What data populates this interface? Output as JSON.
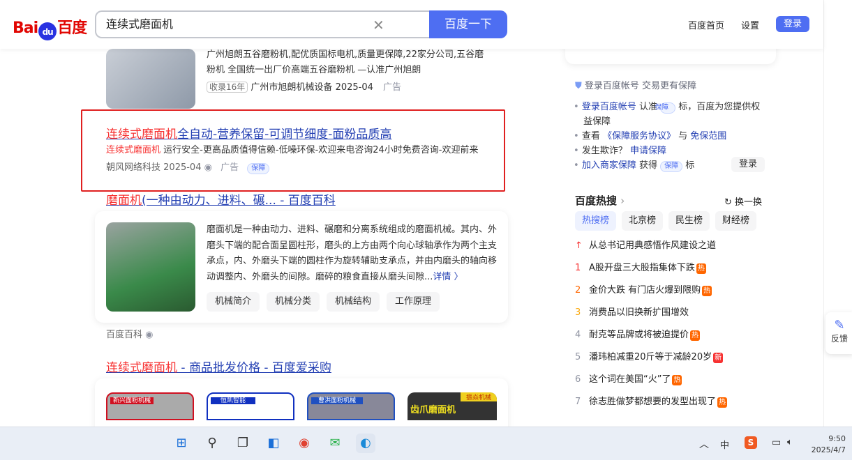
{
  "header": {
    "logo": "Bai度百度",
    "query": "连续式磨面机",
    "search_button": "百度一下",
    "home": "百度首页",
    "settings": "设置",
    "login": "登录"
  },
  "results": [
    {
      "desc": "广州旭朗五谷磨粉机,配优质国标电机,质量更保障,22家分公司,五谷磨粉机 全国统一出厂价高端五谷磨粉机 —认准广州旭朗",
      "badge": "收录16年",
      "source": "广州市旭朗机械设备",
      "date": "2025-04",
      "ad": "广告"
    },
    {
      "title_red": "连续式磨面机",
      "title_rest": "全自动-营养保留-可调节细度-面粉品质高",
      "desc_red": "连续式磨面机",
      "desc": " 运行安全-更高品质值得信赖-低噪环保-欢迎来电咨询24小时免费咨询-欢迎前来",
      "source": "朝风网络科技",
      "date": "2025-04",
      "ad": "广告",
      "guarantee": "保障"
    },
    {
      "title_red": "磨面机",
      "title_rest": "(一种由动力、进料、碾... - 百度百科",
      "desc": "磨面机是一种由动力、进料、碾磨和分离系统组成的磨面机械。其内、外磨头下端的配合面呈圆柱形，磨头的上方由两个向心球轴承作为两个主支承点，内、外磨头下端的圆柱作为旋转辅助支承点，并由内磨头的轴向移动调整内、外磨头的间隙。磨碎的粮食直接从磨头间隙...",
      "more": "详情 〉",
      "chips": [
        "机械简介",
        "机械分类",
        "机械结构",
        "工作原理"
      ],
      "source": "百度百科"
    },
    {
      "title_red": "连续式磨面机",
      "title_rest": " - 商品批发价格 - 百度爱采购",
      "products": [
        "新兴面粉机械",
        "恒凯智能",
        "曹洪面粉机械",
        "振焱机械"
      ],
      "product_caption": "齿爪磨面机"
    }
  ],
  "guarantee": {
    "heading": "登录百度帐号 交易更有保障",
    "items": [
      {
        "a": "登录百度帐号",
        "b": " 认准 ",
        "c": " 标，百度为您提供权益保障"
      },
      {
        "a": "查看 ",
        "b": "《保障服务协议》",
        "c": " 与 ",
        "d": "免保范围"
      },
      {
        "a": "发生欺诈？ ",
        "b": "申请保障"
      },
      {
        "a": "加入商家保障",
        "b": " 获得 ",
        "c": " 标"
      }
    ],
    "badge": "保障",
    "login": "登录"
  },
  "hot": {
    "title": "百度热搜",
    "refresh": "换一换",
    "tabs": [
      "热搜榜",
      "北京榜",
      "民生榜",
      "财经榜"
    ],
    "items": [
      {
        "rank": "↑",
        "text": "从总书记用典感悟作风建设之道",
        "tag": ""
      },
      {
        "rank": "1",
        "text": "A股开盘三大股指集体下跌",
        "tag": "热"
      },
      {
        "rank": "2",
        "text": "金价大跌 有门店火爆到限购",
        "tag": "热"
      },
      {
        "rank": "3",
        "text": "消费品以旧换新扩围增效",
        "tag": ""
      },
      {
        "rank": "4",
        "text": "耐克等品牌或将被迫提价",
        "tag": "热"
      },
      {
        "rank": "5",
        "text": "潘玮柏减重20斤等于减龄20岁",
        "tag": "新"
      },
      {
        "rank": "6",
        "text": "这个词在美国“火”了",
        "tag": "热"
      },
      {
        "rank": "7",
        "text": "徐志胜做梦都想要的发型出现了",
        "tag": "热"
      }
    ]
  },
  "feedback": "反馈",
  "taskbar": {
    "time": "9:50",
    "date": "2025/4/7",
    "ime": "中"
  },
  "colors": {
    "accent": "#4e6ef2",
    "red": "#f73131",
    "link": "#2440b3"
  }
}
